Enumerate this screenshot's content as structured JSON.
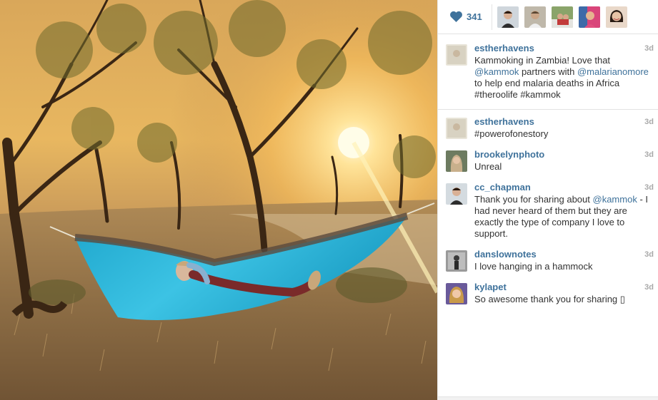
{
  "likes": {
    "count": "341",
    "icon": "heart-icon",
    "color": "#3f729b",
    "likers": [
      "liker-1",
      "liker-2",
      "liker-3",
      "liker-4",
      "liker-5"
    ]
  },
  "caption": {
    "user": "estherhavens",
    "time": "3d",
    "text_part1": "Kammoking in Zambia! Love that ",
    "mention1": "@kammok",
    "text_part2": " partners with ",
    "mention2": "@malarianomore",
    "text_part3": " to help end malaria deaths in Africa #theroolife #kammok"
  },
  "comments": [
    {
      "user": "estherhavens",
      "time": "3d",
      "text": "#powerofonestory"
    },
    {
      "user": "brookelynphoto",
      "time": "3d",
      "text": "Unreal"
    },
    {
      "user": "cc_chapman",
      "time": "3d",
      "text_part1": "Thank you for sharing about ",
      "mention": "@kammok",
      "text_part2": " - I had never heard of them but they are exactly the type of company I love to support."
    },
    {
      "user": "danslownotes",
      "time": "3d",
      "text": "I love hanging in a hammock"
    },
    {
      "user": "kylapet",
      "time": "3d",
      "text": "So awesome thank you for sharing ▯"
    }
  ],
  "colors": {
    "link": "#3f729b",
    "timestamp": "#a9a9a9",
    "hammock": "#2bb5d8"
  }
}
